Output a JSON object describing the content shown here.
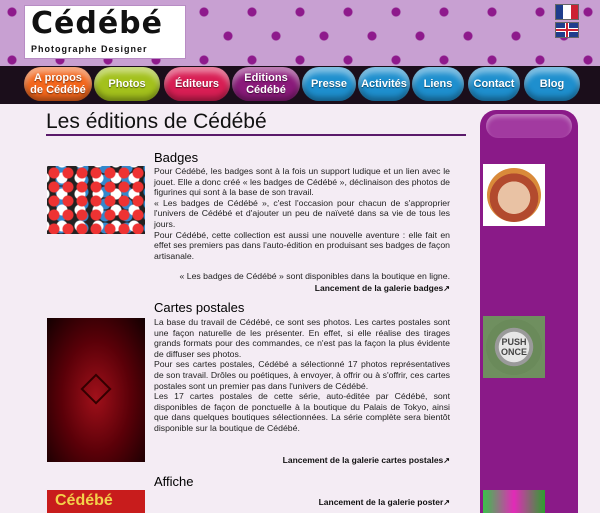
{
  "header": {
    "logo_title": "Cédébé",
    "logo_tagline": "Photographe Designer",
    "pattern_color": "#8e1a8c",
    "background_color": "#c8a0d2",
    "languages": [
      "fr-flag-icon",
      "uk-flag-icon"
    ]
  },
  "nav": [
    {
      "line1": "A propos",
      "line2": "de Cédébé",
      "color": "#f2661c"
    },
    {
      "line1": "Photos",
      "line2": "",
      "color": "#a3c11c"
    },
    {
      "line1": "Éditeurs",
      "line2": "",
      "color": "#d81e54"
    },
    {
      "line1": "Editions",
      "line2": "Cédébé",
      "color": "#8a1a7a"
    },
    {
      "line1": "Presse",
      "line2": "",
      "color": "#1e8fce"
    },
    {
      "line1": "Activités",
      "line2": "",
      "color": "#1e8fce"
    },
    {
      "line1": "Liens",
      "line2": "",
      "color": "#1e8fce"
    },
    {
      "line1": "Contact",
      "line2": "",
      "color": "#1e8fce"
    },
    {
      "line1": "Blog",
      "line2": "",
      "color": "#1e8fce"
    }
  ],
  "page_title": "Les éditions de Cédébé",
  "sections": {
    "badges": {
      "title": "Badges",
      "p1": "Pour Cédébé, les badges sont à la fois un support ludique et un lien avec le jouet. Elle a donc créé « les badges de Cédébé », déclinaison des photos de figurines qui sont à la base de son travail.",
      "p2": "« Les badges de Cédébé », c'est l'occasion pour chacun de s'approprier l'univers de Cédébé et d'ajouter un peu de naïveté dans sa vie de tous les jours.",
      "p3": "Pour Cédébé, cette collection est aussi une nouvelle aventure : elle fait en effet ses premiers pas dans l'auto-édition en produisant ses badges de façon artisanale.",
      "available": "« Les badges de Cédébé » sont disponibles dans la boutique en ligne.",
      "link": "Lancement de la galerie badges"
    },
    "cartes": {
      "title": "Cartes postales",
      "p1": "La base du travail de Cédébé, ce sont ses photos. Les cartes postales sont une façon naturelle de les présenter. En effet, si elle réalise des tirages grands formats pour des commandes, ce n'est pas la façon la plus évidente de diffuser ses photos.",
      "p2": "Pour ses cartes postales, Cédébé a sélectionné 17 photos représentatives de son travail. Drôles ou poétiques, à envoyer, à offrir ou à s'offrir, ces cartes postales sont un premier pas dans l'univers de Cédébé.",
      "p3": "Les 17 cartes postales de cette série, auto-éditée par Cédébé, sont disponibles de façon de ponctuelle à la boutique du Palais de Tokyo, ainsi que dans quelques boutiques sélectionnées. La série complète sera bientôt disponible sur la boutique de Cédébé.",
      "link": "Lancement de la galerie cartes postales"
    },
    "affiche": {
      "title": "Affiche",
      "link": "Lancement de la galerie poster",
      "thumb_text": "Cédébé"
    }
  },
  "sidebar": {
    "push_text_1": "PUSH",
    "push_text_2": "ONCE"
  },
  "link_icon": "external-link-icon"
}
